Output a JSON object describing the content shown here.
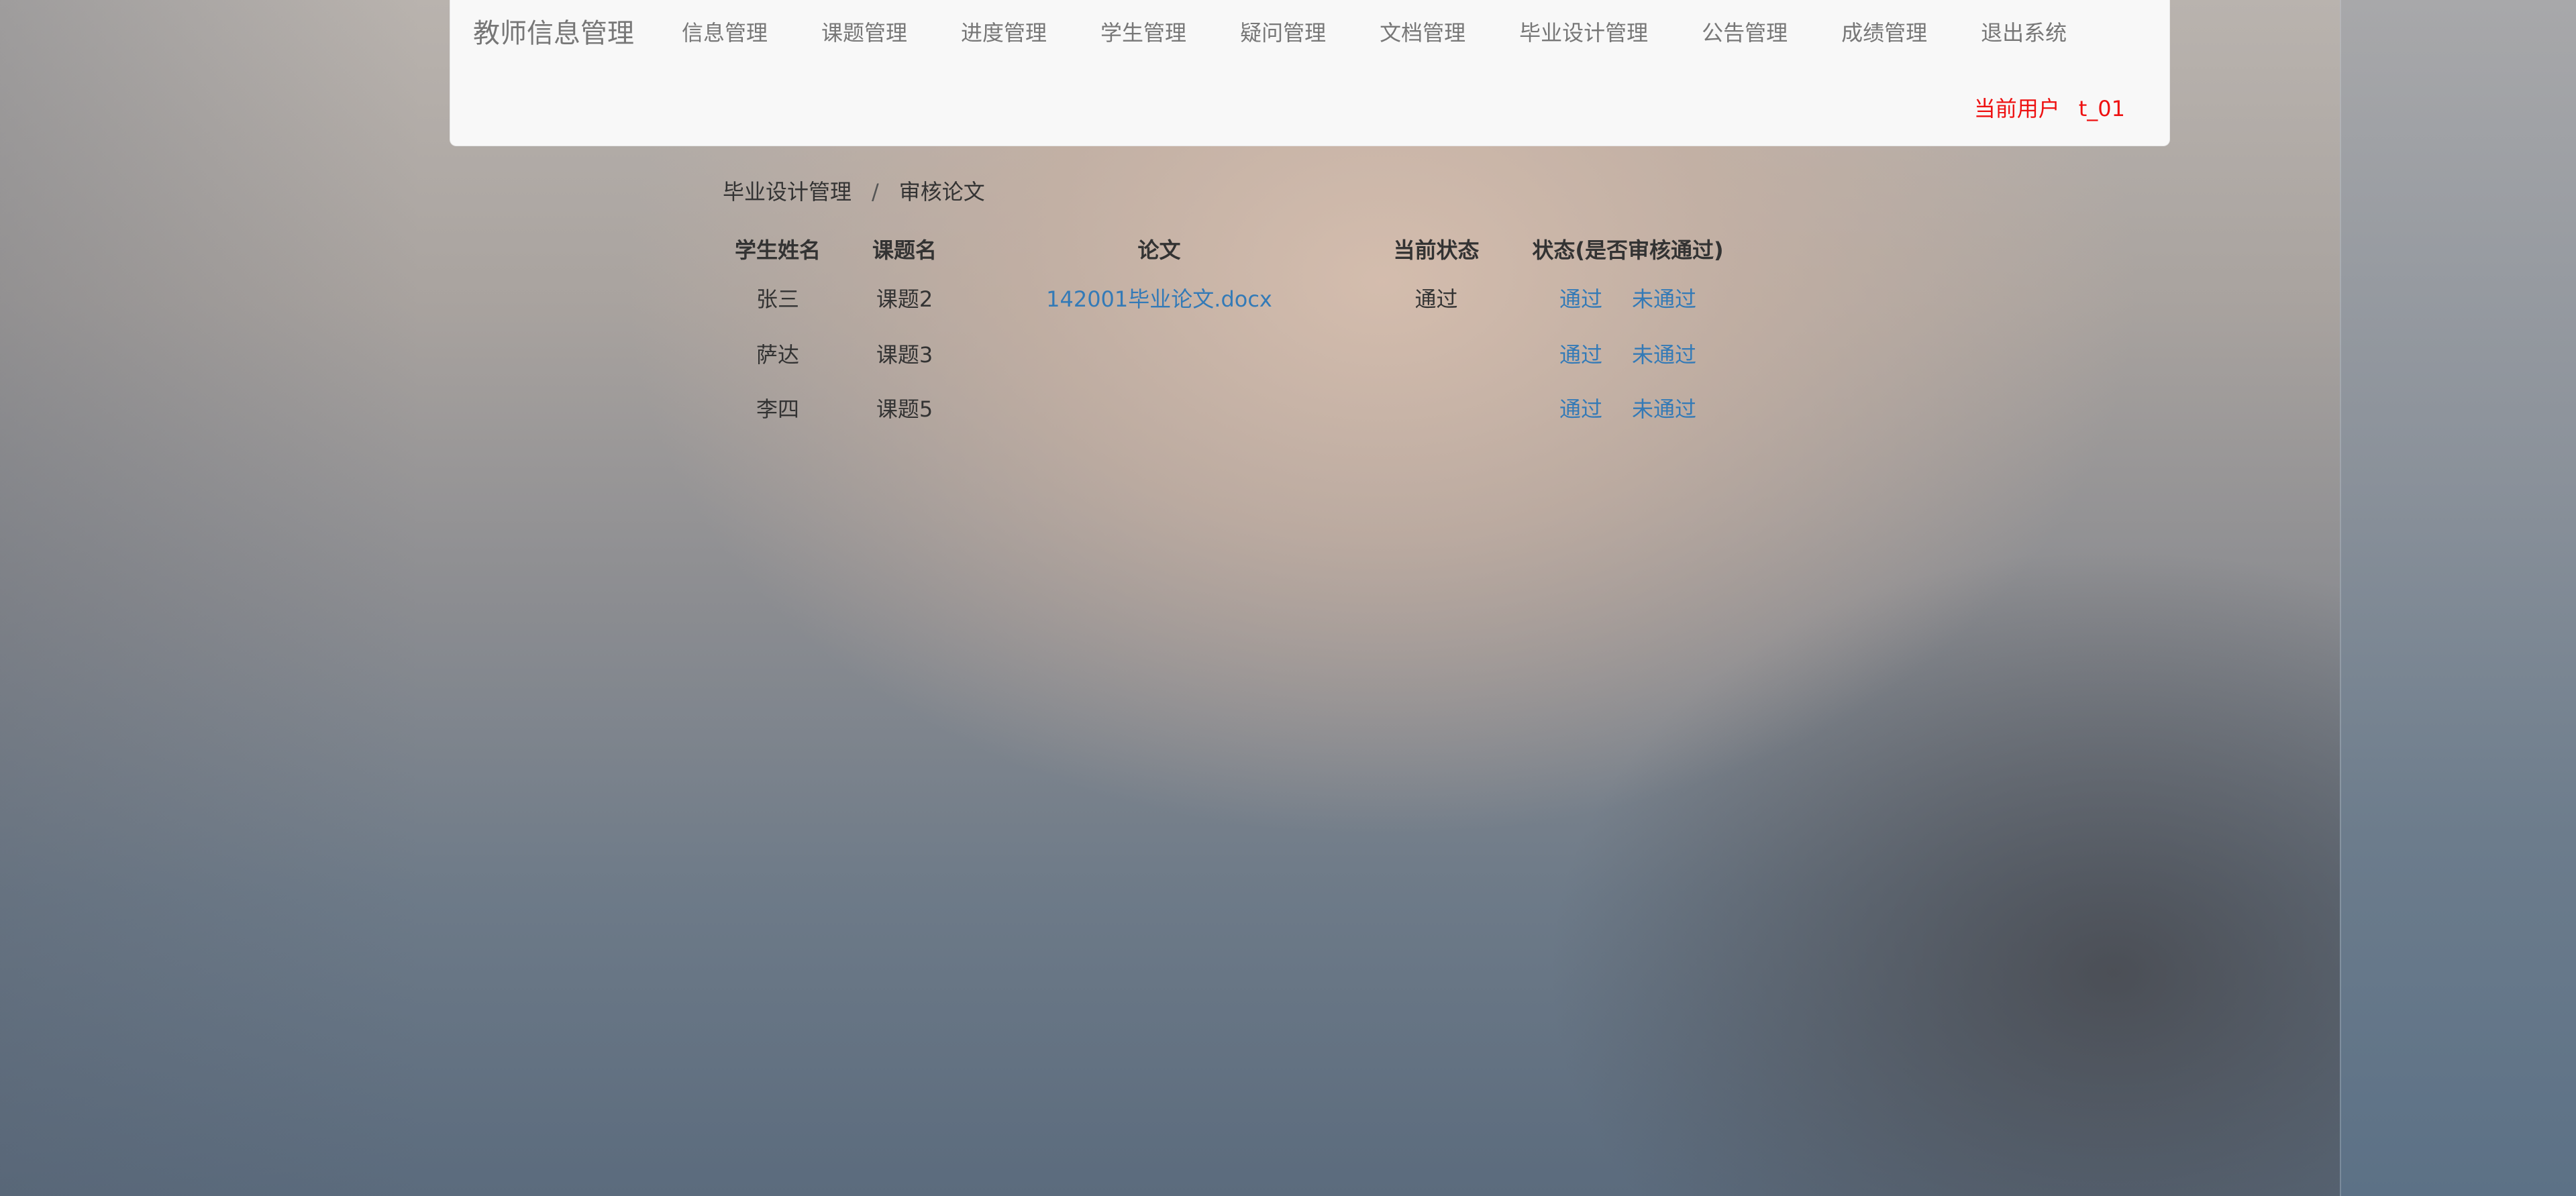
{
  "navbar": {
    "brand": "教师信息管理",
    "items": [
      {
        "label": "信息管理"
      },
      {
        "label": "课题管理"
      },
      {
        "label": "进度管理"
      },
      {
        "label": "学生管理"
      },
      {
        "label": "疑问管理"
      },
      {
        "label": "文档管理"
      },
      {
        "label": "毕业设计管理"
      },
      {
        "label": "公告管理"
      },
      {
        "label": "成绩管理"
      },
      {
        "label": "退出系统"
      }
    ],
    "current_user_label": "当前用户",
    "current_user_value": "t_01"
  },
  "breadcrumb": {
    "parent": "毕业设计管理",
    "divider": "/",
    "current": "审核论文"
  },
  "table": {
    "headers": [
      "学生姓名",
      "课题名",
      "论文",
      "当前状态",
      "状态(是否审核通过)"
    ],
    "rows": [
      {
        "student": "张三",
        "topic": "课题2",
        "paper": "142001毕业论文.docx",
        "status": "通过",
        "pass_label": "通过",
        "fail_label": "未通过"
      },
      {
        "student": "萨达",
        "topic": "课题3",
        "paper": "",
        "status": "",
        "pass_label": "通过",
        "fail_label": "未通过"
      },
      {
        "student": "李四",
        "topic": "课题5",
        "paper": "",
        "status": "",
        "pass_label": "通过",
        "fail_label": "未通过"
      }
    ]
  },
  "colors": {
    "link": "#337ab7",
    "current_user": "#ee1111",
    "nav_text": "#777777",
    "navbar_bg": "#f8f8f8"
  }
}
